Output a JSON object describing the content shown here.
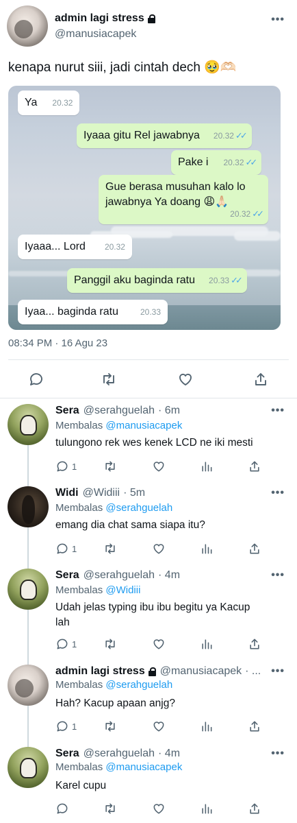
{
  "tweet": {
    "author_name": "admin lagi stress",
    "author_handle": "@manusiacapek",
    "text": "kenapa nurut siii, jadi cintah dech 🥹🫶🏻",
    "more_label": "•••",
    "timestamp": "08:34 PM · 16 Agu 23",
    "chat": {
      "messages": [
        {
          "dir": "in",
          "text": "Ya",
          "time": "20.32",
          "ticks": ""
        },
        {
          "dir": "out",
          "text": "Iyaaa gitu Rel jawabnya",
          "time": "20.32",
          "ticks": "✓✓"
        },
        {
          "dir": "out",
          "text": "Pake i",
          "time": "20.32",
          "ticks": "✓✓"
        },
        {
          "dir": "out",
          "text": "Gue berasa musuhan kalo lo jawabnya Ya doang 😩🙏🏻",
          "time": "20.32",
          "ticks": "✓✓"
        },
        {
          "dir": "in",
          "text": "Iyaaa... Lord",
          "time": "20.32",
          "ticks": ""
        },
        {
          "dir": "out",
          "text": "Panggil aku baginda ratu",
          "time": "20.33",
          "ticks": "✓✓"
        },
        {
          "dir": "in",
          "text": "Iyaa... baginda ratu",
          "time": "20.33",
          "ticks": ""
        }
      ]
    },
    "actions": [
      "reply-icon",
      "retweet-icon",
      "like-icon",
      "share-icon"
    ]
  },
  "replies": [
    {
      "name": "Sera",
      "handle": "@serahguelah",
      "time": "· 6m",
      "reply_prefix": "Membalas",
      "reply_to": "@manusiacapek",
      "text": "tulungono rek wes kenek LCD ne iki mesti",
      "reply_count": "1"
    },
    {
      "name": "Widi",
      "handle": "@Widiii",
      "time": "· 5m",
      "reply_prefix": "Membalas",
      "reply_to": "@serahguelah",
      "text": "emang dia chat sama siapa itu?",
      "reply_count": "1"
    },
    {
      "name": "Sera",
      "handle": "@serahguelah",
      "time": "· 4m",
      "reply_prefix": "Membalas",
      "reply_to": "@Widiii",
      "text": "Udah jelas typing ibu ibu begitu ya Kacup lah",
      "reply_count": "1"
    },
    {
      "name": "admin lagi stress",
      "handle": "@manusiacapek",
      "time": "· ...",
      "reply_prefix": "Membalas",
      "reply_to": "@serahguelah",
      "text": "Hah? Kacup apaan anjg?",
      "reply_count": "1"
    },
    {
      "name": "Sera",
      "handle": "@serahguelah",
      "time": "· 4m",
      "reply_prefix": "Membalas",
      "reply_to": "@manusiacapek",
      "text": "Karel cupu",
      "reply_count": ""
    }
  ],
  "colors": {
    "accent": "#1d9bf0",
    "muted": "#536471",
    "bubble_out": "#dcf8c6",
    "bubble_in": "#ffffff",
    "ticks": "#4fa7e8"
  }
}
